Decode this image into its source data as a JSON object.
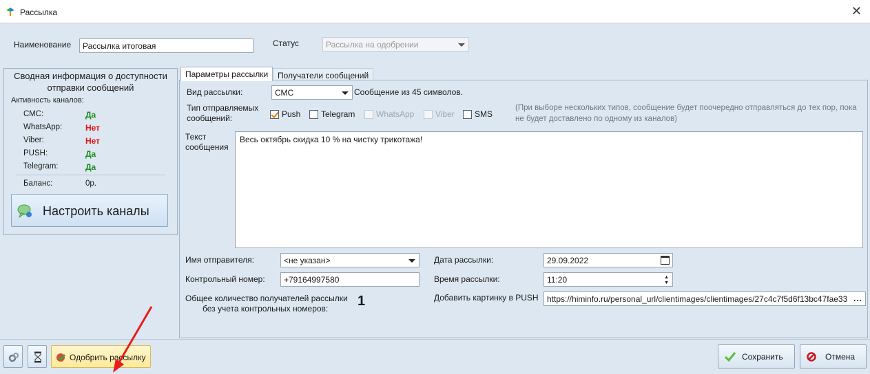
{
  "window": {
    "title": "Рассылка",
    "close_glyph": "✕"
  },
  "form": {
    "name_label": "Наименование",
    "name_value": "Рассылка итоговая",
    "status_label": "Статус",
    "status_value": "Рассылка на одобрении"
  },
  "summary": {
    "header_line1": "Сводная информация о доступности",
    "header_line2": "отправки сообщений",
    "activity_label": "Активность каналов:",
    "channels": [
      {
        "name": "СМС:",
        "value": "Да",
        "color": "#1e8a1e"
      },
      {
        "name": "WhatsApp:",
        "value": "Нет",
        "color": "#e01414"
      },
      {
        "name": "Viber:",
        "value": "Нет",
        "color": "#e01414"
      },
      {
        "name": "PUSH:",
        "value": "Да",
        "color": "#1e8a1e"
      },
      {
        "name": "Telegram:",
        "value": "Да",
        "color": "#1e8a1e"
      }
    ],
    "balance_label": "Баланс:",
    "balance_value": "0р.",
    "setup_button": "Настроить каналы",
    "setup_icon": "sms-bubble-icon"
  },
  "tabs": [
    {
      "label": "Параметры рассылки",
      "active": true
    },
    {
      "label": "Получатели сообщений",
      "active": false
    }
  ],
  "params": {
    "type_label": "Вид рассылки:",
    "type_value": "СМС",
    "type_info": "Сообщение из 45 символов.",
    "msgtypes_label_1": "Тип отправляемых",
    "msgtypes_label_2": "сообщений:",
    "msgtypes": [
      {
        "label": "Push",
        "checked": true,
        "enabled": true
      },
      {
        "label": "Telegram",
        "checked": false,
        "enabled": true
      },
      {
        "label": "WhatsApp",
        "checked": false,
        "enabled": false
      },
      {
        "label": "Viber",
        "checked": false,
        "enabled": false
      },
      {
        "label": "SMS",
        "checked": false,
        "enabled": true
      }
    ],
    "hint": "(При выборе нескольких типов, сообщение будет поочередно отправляться до тех пор, пока не будет доставлено по одному из каналов)",
    "text_label_1": "Текст",
    "text_label_2": "сообщения",
    "text_value": "Весь октябрь скидка 10 % на чистку трикотажа!",
    "sender_label": "Имя отправителя:",
    "sender_value": "<не указан>",
    "control_label": "Контрольный номер:",
    "control_value": "+79164997580",
    "recipients_label_1": "Общее количество получателей рассылки",
    "recipients_label_2": "без учета контрольных номеров:",
    "recipients_count": "1",
    "date_label": "Дата рассылки:",
    "date_value": "29.09.2022",
    "time_label": "Время рассылки:",
    "time_value": "11:20",
    "picture_label": "Добавить картинку в PUSH",
    "picture_value": "https://himinfo.ru/personal_url/clientimages/clientimages/27c4c7f5d6f13bc47fae33",
    "picture_more": "..."
  },
  "bottom": {
    "approve_label": "Одобрить рассылку",
    "save_label": "Сохранить",
    "cancel_label": "Отмена"
  }
}
